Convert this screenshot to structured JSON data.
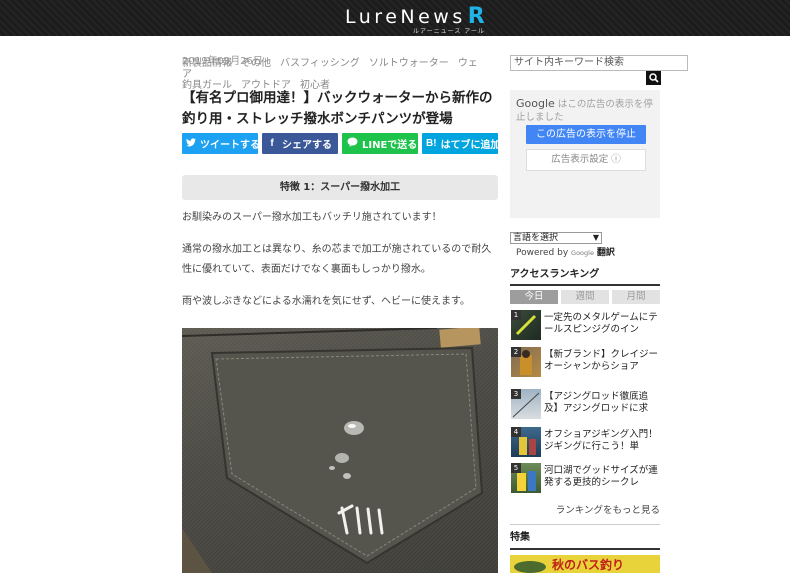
{
  "header": {
    "logo_main": "LureNews",
    "logo_r": "R",
    "logo_sub": "ルアーニュース アール"
  },
  "article": {
    "date": "2019年09月26日",
    "tags": [
      "新製品情報",
      "その他",
      "バスフィッシング",
      "ソルトウォーター",
      "ウェア",
      "釣具ガール",
      "アウトドア",
      "初心者"
    ],
    "title": "【有名プロ御用達！】バックウォーターから新作の釣り用・ストレッチ撥水ボンチパンツが登場",
    "share": {
      "twitter": "ツイートする",
      "facebook": "シェアする",
      "line": "LINEで送る",
      "hatena": "はてブに追加"
    },
    "section_heading": "特徴 1：スーパー撥水加工",
    "paragraphs": [
      "お馴染みのスーパー撥水加工もバッチリ施されています！",
      "通常の撥水加工とは異なり、糸の芯まで加工が施されているので耐久性に優れていて、表面だけでなく裏面もしっかり撥水。",
      "雨や波しぶきなどによる水濡れを気にせず、ヘビーに使えます。"
    ]
  },
  "sidebar": {
    "search_value": "サイト内キーワード検索",
    "ad": {
      "google": "Google",
      "message": "はこの広告の表示を停止しました",
      "stop_button": "この広告の表示を停止",
      "settings_button": "広告表示設定 ⓘ"
    },
    "language_select": "言語を選択",
    "powered_by": "Powered by",
    "google_small": "Google",
    "translate": "翻訳",
    "ranking": {
      "heading": "アクセスランキング",
      "tabs": [
        "今日",
        "週間",
        "月間"
      ],
      "items": [
        {
          "num": "1",
          "text": "一定先のメタルゲームにテールスピンジグのイン"
        },
        {
          "num": "2",
          "text": "【新ブランド】クレイジーオーシャンからショア"
        },
        {
          "num": "3",
          "text": "【アジングロッド徹底追及】アジングロッドに求"
        },
        {
          "num": "4",
          "text": "オフショアジギング入門！ジギングに行こう！単"
        },
        {
          "num": "5",
          "text": "河口湖でグッドサイズが連発する更技的シークレ"
        }
      ],
      "more": "ランキングをもっと見る"
    },
    "feature_heading": "特集",
    "feature_banner": "秋のバス釣り"
  },
  "colors": {
    "twitter": "#1da1f2",
    "facebook": "#3b5998",
    "line": "#1dc34b",
    "hatena": "#00a4de",
    "logo_accent": "#1fb3e8",
    "ad_button": "#4285f4"
  }
}
